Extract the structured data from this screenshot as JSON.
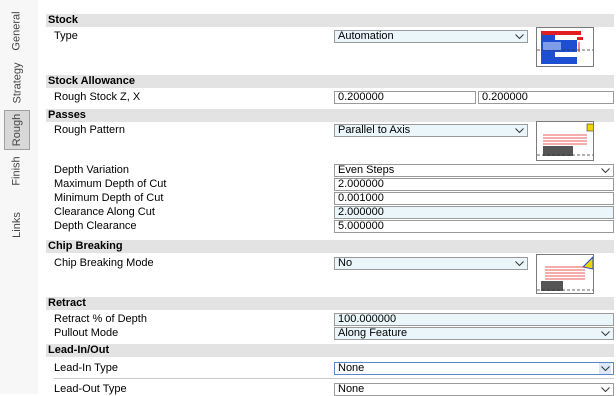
{
  "tabs": [
    {
      "label": "General",
      "active": false
    },
    {
      "label": "Strategy",
      "active": false
    },
    {
      "label": "Rough",
      "active": true
    },
    {
      "label": "Finish",
      "active": false
    },
    {
      "label": "Links",
      "active": false
    }
  ],
  "stock": {
    "header": "Stock",
    "type_label": "Type",
    "type_value": "Automation",
    "preview_icon": "stock-automation-preview-icon"
  },
  "stock_allowance": {
    "header": "Stock Allowance",
    "rough_label": "Rough Stock Z, X",
    "rough_z": "0.200000",
    "rough_x": "0.200000"
  },
  "passes": {
    "header": "Passes",
    "pattern_label": "Rough Pattern",
    "pattern_value": "Parallel to Axis",
    "preview_icon": "parallel-to-axis-preview-icon",
    "depth_variation_label": "Depth Variation",
    "depth_variation_value": "Even Steps",
    "max_depth_label": "Maximum Depth of Cut",
    "max_depth_value": "2.000000",
    "min_depth_label": "Minimum Depth of Cut",
    "min_depth_value": "0.001000",
    "clearance_along_label": "Clearance Along Cut",
    "clearance_along_value": "2.000000",
    "depth_clearance_label": "Depth Clearance",
    "depth_clearance_value": "5.000000"
  },
  "chip_breaking": {
    "header": "Chip Breaking",
    "mode_label": "Chip Breaking Mode",
    "mode_value": "No",
    "preview_icon": "chip-breaking-preview-icon"
  },
  "retract": {
    "header": "Retract",
    "percent_label": "Retract % of Depth",
    "percent_value": "100.000000",
    "pullout_label": "Pullout Mode",
    "pullout_value": "Along Feature"
  },
  "lead": {
    "header": "Lead-In/Out",
    "in_label": "Lead-In Type",
    "in_value": "None",
    "out_label": "Lead-Out Type",
    "out_value": "None"
  },
  "colors": {
    "header_bg": "#e3e3e3",
    "field_tint": "#eaf6fa",
    "accent_blue": "#1e4fd0",
    "accent_red": "#e02020",
    "accent_yellow": "#f0d400"
  }
}
